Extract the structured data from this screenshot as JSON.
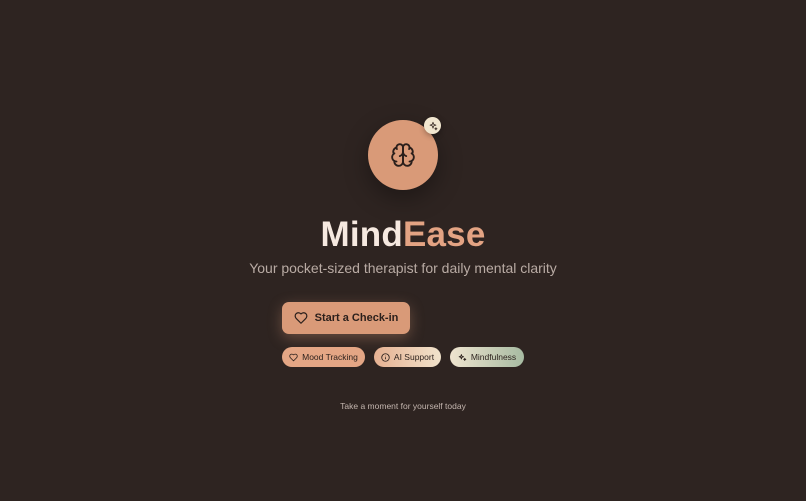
{
  "brand": {
    "name_part1": "Mind",
    "name_part2": "Ease",
    "tagline": "Your pocket-sized therapist for daily mental clarity",
    "logo_icon": "brain-icon",
    "badge_icon": "sparkle-icon"
  },
  "cta": {
    "label": "Start a Check-in",
    "icon": "heart-icon"
  },
  "features": [
    {
      "label": "Mood Tracking",
      "icon": "heart-icon"
    },
    {
      "label": "AI Support",
      "icon": "info-icon"
    },
    {
      "label": "Mindfulness",
      "icon": "sparkle-icon"
    }
  ],
  "footer": {
    "note": "Take a moment for yourself today"
  },
  "colors": {
    "background": "#2e2421",
    "accent": "#d99a78",
    "title_light": "#f6e9e0",
    "title_accent": "#e3a383",
    "sage": "#a7bba2",
    "cream": "#f1e6cf"
  }
}
